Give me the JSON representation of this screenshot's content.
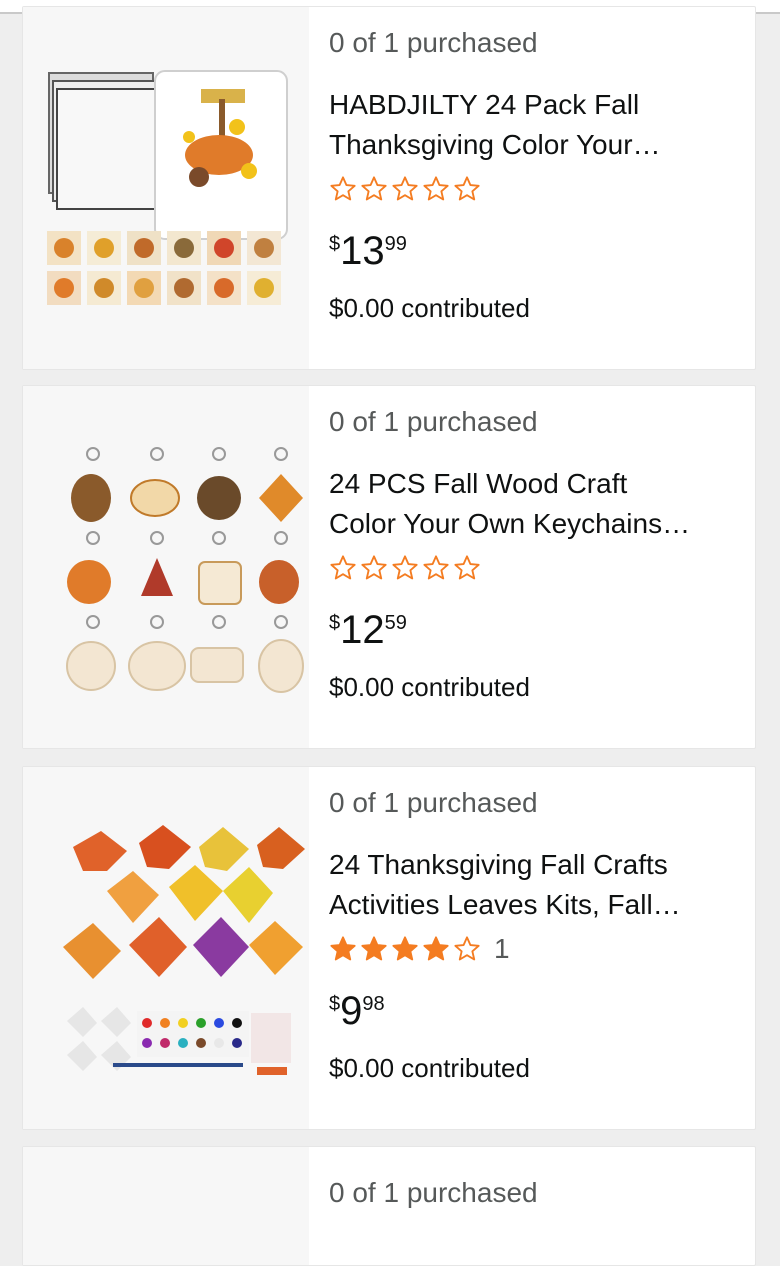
{
  "colors": {
    "star": "#f47c21",
    "text": "#0f1111",
    "muted": "#565959"
  },
  "items": [
    {
      "purchased": "0 of 1 purchased",
      "title_line1": "HABDJILTY 24 Pack Fall",
      "title_line2": "Thanksgiving Color Your…",
      "rating": 0,
      "review_count": "",
      "price_currency": "$",
      "price_whole": "13",
      "price_fraction": "99",
      "contributed": "$0.00 contributed",
      "image_icon": "puzzle-craft-image"
    },
    {
      "purchased": "0 of 1 purchased",
      "title_line1": "24 PCS Fall Wood Craft",
      "title_line2": "Color Your Own Keychains…",
      "rating": 0,
      "review_count": "",
      "price_currency": "$",
      "price_whole": "12",
      "price_fraction": "59",
      "contributed": "$0.00 contributed",
      "image_icon": "keychain-craft-image"
    },
    {
      "purchased": "0 of 1 purchased",
      "title_line1": "24 Thanksgiving Fall Crafts",
      "title_line2": "Activities Leaves Kits, Fall…",
      "rating": 4,
      "review_count": "1",
      "price_currency": "$",
      "price_whole": "9",
      "price_fraction": "98",
      "contributed": "$0.00 contributed",
      "image_icon": "leaves-craft-image"
    },
    {
      "purchased": "0 of 1 purchased"
    }
  ]
}
